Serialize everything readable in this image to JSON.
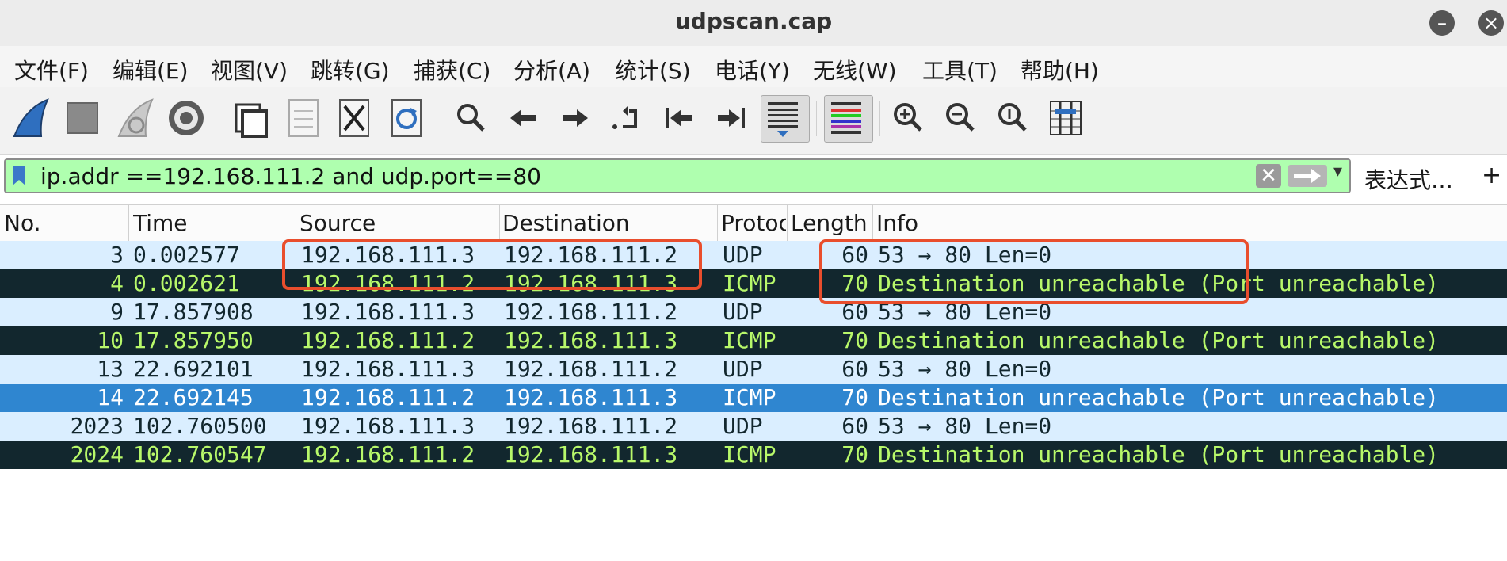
{
  "window": {
    "title": "udpscan.cap",
    "minimize_label": "–",
    "close_label": "×"
  },
  "menu": [
    "文件(F)",
    "编辑(E)",
    "视图(V)",
    "跳转(G)",
    "捕获(C)",
    "分析(A)",
    "统计(S)",
    "电话(Y)",
    "无线(W)",
    "工具(T)",
    "帮助(H)"
  ],
  "toolbar": {
    "icons": [
      "shark-fin-start-icon",
      "stop-square-icon",
      "restart-fin-icon",
      "capture-options-gear-icon",
      "open-file-icon",
      "save-file-icon",
      "close-file-icon",
      "reload-file-icon",
      "find-packet-icon",
      "back-arrow-icon",
      "forward-arrow-icon",
      "go-to-packet-icon",
      "first-packet-icon",
      "last-packet-icon",
      "auto-scroll-icon",
      "colorize-icon",
      "zoom-in-icon",
      "zoom-out-icon",
      "normal-size-icon",
      "resize-columns-icon"
    ]
  },
  "filter": {
    "value": "ip.addr ==192.168.111.2 and udp.port==80",
    "clear_label": "✕",
    "dropdown_label": "▾",
    "expression_label": "表达式…",
    "add_label": "+",
    "bg_color": "#afffaf"
  },
  "columns": [
    "No.",
    "Time",
    "Source",
    "Destination",
    "Protocol",
    "Length",
    "Info"
  ],
  "packets": [
    {
      "no": "3",
      "time": "0.002577",
      "source": "192.168.111.3",
      "destination": "192.168.111.2",
      "protocol": "UDP",
      "length": "60",
      "info": "53 → 80 Len=0",
      "style": "udp"
    },
    {
      "no": "4",
      "time": "0.002621",
      "source": "192.168.111.2",
      "destination": "192.168.111.3",
      "protocol": "ICMP",
      "length": "70",
      "info": "Destination unreachable (Port unreachable)",
      "style": "icmp"
    },
    {
      "no": "9",
      "time": "17.857908",
      "source": "192.168.111.3",
      "destination": "192.168.111.2",
      "protocol": "UDP",
      "length": "60",
      "info": "53 → 80 Len=0",
      "style": "udp"
    },
    {
      "no": "10",
      "time": "17.857950",
      "source": "192.168.111.2",
      "destination": "192.168.111.3",
      "protocol": "ICMP",
      "length": "70",
      "info": "Destination unreachable (Port unreachable)",
      "style": "icmp"
    },
    {
      "no": "13",
      "time": "22.692101",
      "source": "192.168.111.3",
      "destination": "192.168.111.2",
      "protocol": "UDP",
      "length": "60",
      "info": "53 → 80 Len=0",
      "style": "udp"
    },
    {
      "no": "14",
      "time": "22.692145",
      "source": "192.168.111.2",
      "destination": "192.168.111.3",
      "protocol": "ICMP",
      "length": "70",
      "info": "Destination unreachable (Port unreachable)",
      "style": "sel"
    },
    {
      "no": "2023",
      "time": "102.760500",
      "source": "192.168.111.3",
      "destination": "192.168.111.2",
      "protocol": "UDP",
      "length": "60",
      "info": "53 → 80 Len=0",
      "style": "udp"
    },
    {
      "no": "2024",
      "time": "102.760547",
      "source": "192.168.111.2",
      "destination": "192.168.111.3",
      "protocol": "ICMP",
      "length": "70",
      "info": "Destination unreachable (Port unreachable)",
      "style": "icmp"
    }
  ],
  "colors": {
    "udp_row_bg": "#daeeff",
    "icmp_row_bg": "#12272e",
    "icmp_row_fg": "#b8f86a",
    "selected_row_bg": "#2f86d0",
    "annotation": "#e94e2d"
  }
}
